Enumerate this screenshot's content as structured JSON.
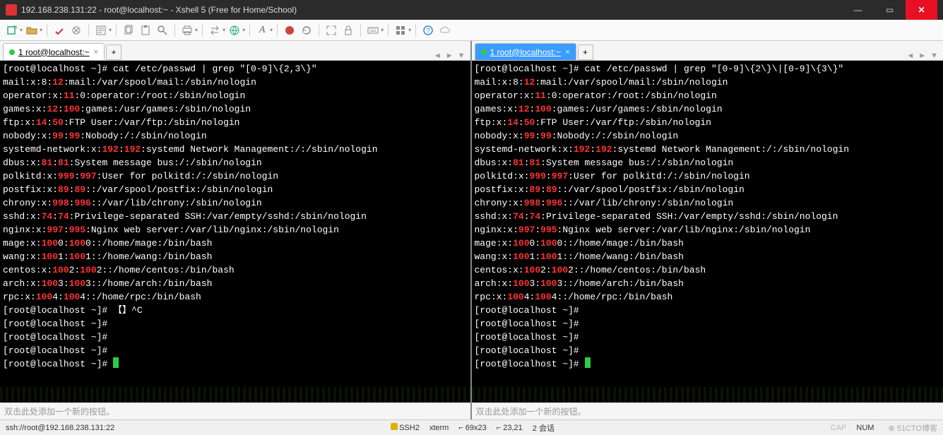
{
  "window": {
    "title": "192.168.238.131:22 - root@localhost:~ - Xshell 5 (Free for Home/School)"
  },
  "tabs": {
    "label": "1 root@localhost:~",
    "add": "+"
  },
  "left": {
    "prompt_cmd": "[root@localhost ~]# cat /etc/passwd | grep \"[0-9]\\{2,3\\}\"",
    "lines": [
      {
        "p": "mail:x:8:",
        "h": "12",
        "s": ":mail:/var/spool/mail:/sbin/nologin"
      },
      {
        "p": "operator:x:",
        "h": "11",
        "s": ":0:operator:/root:/sbin/nologin"
      },
      {
        "p": "games:x:",
        "h": "12",
        "m": ":",
        "h2": "100",
        "s": ":games:/usr/games:/sbin/nologin"
      },
      {
        "p": "ftp:x:",
        "h": "14",
        "m": ":",
        "h2": "50",
        "s": ":FTP User:/var/ftp:/sbin/nologin"
      },
      {
        "p": "nobody:x:",
        "h": "99",
        "m": ":",
        "h2": "99",
        "s": ":Nobody:/:/sbin/nologin"
      },
      {
        "p": "systemd-network:x:",
        "h": "192",
        "m": ":",
        "h2": "192",
        "s": ":systemd Network Management:/:/sbin/nologin"
      },
      {
        "p": "dbus:x:",
        "h": "81",
        "m": ":",
        "h2": "81",
        "s": ":System message bus:/:/sbin/nologin"
      },
      {
        "p": "polkitd:x:",
        "h": "999",
        "m": ":",
        "h2": "997",
        "s": ":User for polkitd:/:/sbin/nologin"
      },
      {
        "p": "postfix:x:",
        "h": "89",
        "m": ":",
        "h2": "89",
        "s": "::/var/spool/postfix:/sbin/nologin"
      },
      {
        "p": "chrony:x:",
        "h": "998",
        "m": ":",
        "h2": "996",
        "s": "::/var/lib/chrony:/sbin/nologin"
      },
      {
        "p": "sshd:x:",
        "h": "74",
        "m": ":",
        "h2": "74",
        "s": ":Privilege-separated SSH:/var/empty/sshd:/sbin/nologin"
      },
      {
        "p": "nginx:x:",
        "h": "997",
        "m": ":",
        "h2": "995",
        "s": ":Nginx web server:/var/lib/nginx:/sbin/nologin"
      },
      {
        "p": "mage:x:",
        "h": "100",
        "m": "0:",
        "h2": "100",
        "s": "0::/home/mage:/bin/bash"
      },
      {
        "p": "wang:x:",
        "h": "100",
        "m": "1:",
        "h2": "100",
        "s": "1::/home/wang:/bin/bash"
      },
      {
        "p": "centos:x:",
        "h": "100",
        "m": "2:",
        "h2": "100",
        "s": "2::/home/centos:/bin/bash"
      },
      {
        "p": "arch:x:",
        "h": "100",
        "m": "3:",
        "h2": "100",
        "s": "3::/home/arch:/bin/bash"
      },
      {
        "p": "rpc:x:",
        "h": "100",
        "m": "4:",
        "h2": "100",
        "s": "4::/home/rpc:/bin/bash"
      }
    ],
    "tail": [
      "[root@localhost ~]# 【】^C",
      "[root@localhost ~]#",
      "[root@localhost ~]#",
      "[root@localhost ~]#",
      "[root@localhost ~]# "
    ]
  },
  "right": {
    "prompt_cmd": "[root@localhost ~]# cat /etc/passwd | grep \"[0-9]\\{2\\}\\|[0-9]\\{3\\}\"",
    "tail": [
      "[root@localhost ~]#",
      "[root@localhost ~]#",
      "[root@localhost ~]#",
      "[root@localhost ~]#",
      "[root@localhost ~]# "
    ]
  },
  "inputbar": "双击此处添加一个新的按钮。",
  "status": {
    "conn": "ssh://root@192.168.238.131:22",
    "ssh": "SSH2",
    "term": "xterm",
    "size": "⌐ 69x23",
    "pos": "⌐ 23,21",
    "sess": "2 会话",
    "cap": "CAP",
    "num": "NUM",
    "wm": "⊕ 51CTO博客"
  },
  "nav": {
    "left": "◄",
    "right": "►",
    "down": "▼"
  }
}
